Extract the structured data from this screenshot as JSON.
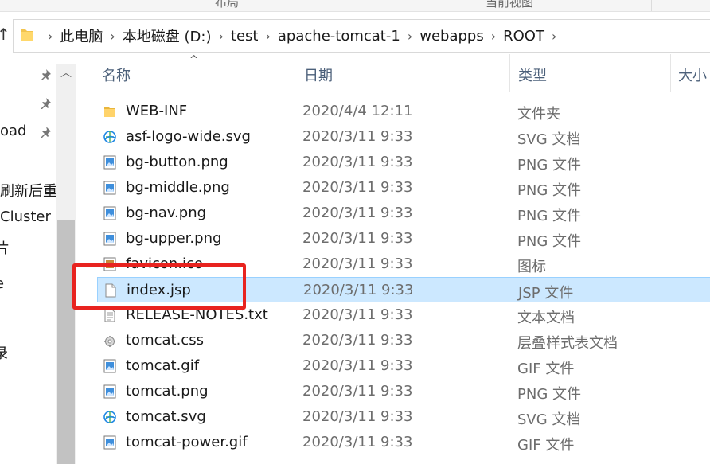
{
  "ribbon": {
    "left_label": "布局",
    "right_label": "当前视图"
  },
  "address": {
    "crumbs": [
      "此电脑",
      "本地磁盘 (D:)",
      "test",
      "apache-tomcat-1",
      "webapps",
      "ROOT"
    ]
  },
  "nav_pane": {
    "items": [
      "oad",
      "刷新后重",
      "Cluster",
      "片",
      "e",
      "录"
    ]
  },
  "columns": {
    "name": "名称",
    "date": "日期",
    "type": "类型",
    "size": "大小"
  },
  "files": [
    {
      "name": "WEB-INF",
      "date": "2020/4/4 12:11",
      "type": "文件夹",
      "icon": "folder-icon"
    },
    {
      "name": "asf-logo-wide.svg",
      "date": "2020/3/11 9:33",
      "type": "SVG 文档",
      "icon": "svg-document-icon"
    },
    {
      "name": "bg-button.png",
      "date": "2020/3/11 9:33",
      "type": "PNG 文件",
      "icon": "image-file-icon"
    },
    {
      "name": "bg-middle.png",
      "date": "2020/3/11 9:33",
      "type": "PNG 文件",
      "icon": "image-file-icon"
    },
    {
      "name": "bg-nav.png",
      "date": "2020/3/11 9:33",
      "type": "PNG 文件",
      "icon": "image-file-icon"
    },
    {
      "name": "bg-upper.png",
      "date": "2020/3/11 9:33",
      "type": "PNG 文件",
      "icon": "image-file-icon"
    },
    {
      "name": "favicon.ico",
      "date": "2020/3/11 9:33",
      "type": "图标",
      "icon": "ico-file-icon"
    },
    {
      "name": "index.jsp",
      "date": "2020/3/11 9:33",
      "type": "JSP 文件",
      "icon": "blank-file-icon"
    },
    {
      "name": "RELEASE-NOTES.txt",
      "date": "2020/3/11 9:33",
      "type": "文本文档",
      "icon": "text-file-icon"
    },
    {
      "name": "tomcat.css",
      "date": "2020/3/11 9:33",
      "type": "层叠样式表文档",
      "icon": "css-file-icon"
    },
    {
      "name": "tomcat.gif",
      "date": "2020/3/11 9:33",
      "type": "GIF 文件",
      "icon": "image-file-icon"
    },
    {
      "name": "tomcat.png",
      "date": "2020/3/11 9:33",
      "type": "PNG 文件",
      "icon": "image-file-icon"
    },
    {
      "name": "tomcat.svg",
      "date": "2020/3/11 9:33",
      "type": "SVG 文档",
      "icon": "svg-document-icon"
    },
    {
      "name": "tomcat-power.gif",
      "date": "2020/3/11 9:33",
      "type": "GIF 文件",
      "icon": "image-file-icon"
    }
  ],
  "selected_index": 7,
  "colors": {
    "selection_bg": "#cce8ff",
    "selection_border": "#99d1ff",
    "annotation_red": "#e8231f",
    "header_text": "#4c607a"
  }
}
